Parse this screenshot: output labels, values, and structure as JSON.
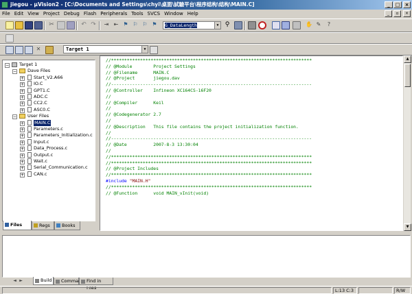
{
  "window": {
    "title": "jiegou - µVision2 - [C:\\Documents and Settings\\chyi\\桌面\\試驗平台\\程序结构\\结构\\MAIN.C]",
    "minimize_glyph": "_",
    "maximize_glyph": "□",
    "close_glyph": "×"
  },
  "menu": [
    "File",
    "Edit",
    "View",
    "Project",
    "Debug",
    "Flash",
    "Peripherals",
    "Tools",
    "SVCS",
    "Window",
    "Help"
  ],
  "toolbar": {
    "find_value": "G_DataLength"
  },
  "build_toolbar": {
    "target_value": "Target 1"
  },
  "project_tree": {
    "root": "Target 1",
    "groups": [
      {
        "label": "Dave Files",
        "files": [
          "Start_V2.A66",
          "IO.C",
          "GPT1.C",
          "ADC.C",
          "CC2.C",
          "ASC0.C"
        ]
      },
      {
        "label": "User Files",
        "files": [
          "MAIN.C",
          "Parameters.c",
          "Parameters_Initialization.c",
          "Input.c",
          "Data_Process.c",
          "Output.c",
          "Wait.c",
          "Serial_Communication.c",
          "CAN.c"
        ]
      }
    ],
    "selected_file": "MAIN.C"
  },
  "left_tabs": [
    "Files",
    "Regs",
    "Books"
  ],
  "editor": {
    "lines": [
      {
        "t": "//****************************************************************************",
        "c": "cm"
      },
      {
        "t": "// @Module        Project Settings",
        "c": "cm"
      },
      {
        "t": "// @Filename      MAIN.C",
        "c": "cm"
      },
      {
        "t": "// @Project       jiegou.dav",
        "c": "cm"
      },
      {
        "t": "//----------------------------------------------------------------------------",
        "c": "cm"
      },
      {
        "t": "// @Controller    Infineon XC164CS-16F20",
        "c": "cm"
      },
      {
        "t": "//",
        "c": "cm"
      },
      {
        "t": "// @Compiler      Keil",
        "c": "cm"
      },
      {
        "t": "//",
        "c": "cm"
      },
      {
        "t": "// @Codegenerator 2.7",
        "c": "cm"
      },
      {
        "t": "//",
        "c": "cm"
      },
      {
        "t": "// @Description   This file contains the project initialization function.",
        "c": "cm"
      },
      {
        "t": "//",
        "c": "cm"
      },
      {
        "t": "//----------------------------------------------------------------------------",
        "c": "cm"
      },
      {
        "t": "// @Date          2007-8-3 13:30:04",
        "c": "cm"
      },
      {
        "t": "//",
        "c": "cm"
      },
      {
        "t": "//****************************************************************************",
        "c": "cm"
      },
      {
        "t": "",
        "c": ""
      },
      {
        "t": "",
        "c": ""
      },
      {
        "t": "",
        "c": ""
      },
      {
        "t": "//****************************************************************************",
        "c": "cm"
      },
      {
        "t": "// @Project Includes",
        "c": "cm"
      },
      {
        "t": "//****************************************************************************",
        "c": "cm"
      },
      {
        "t": "",
        "c": ""
      },
      {
        "t": "#include \"MAIN.H\"",
        "c": "inc"
      },
      {
        "t": "",
        "c": ""
      },
      {
        "t": "",
        "c": ""
      },
      {
        "t": "//****************************************************************************",
        "c": "cm"
      },
      {
        "t": "// @Function      void MAIN_vInit(void)",
        "c": "cm"
      }
    ]
  },
  "output_tabs": [
    "Build",
    "Command",
    "Find in Files"
  ],
  "status": {
    "position": "L:13 C:3",
    "mode": "R/W"
  }
}
